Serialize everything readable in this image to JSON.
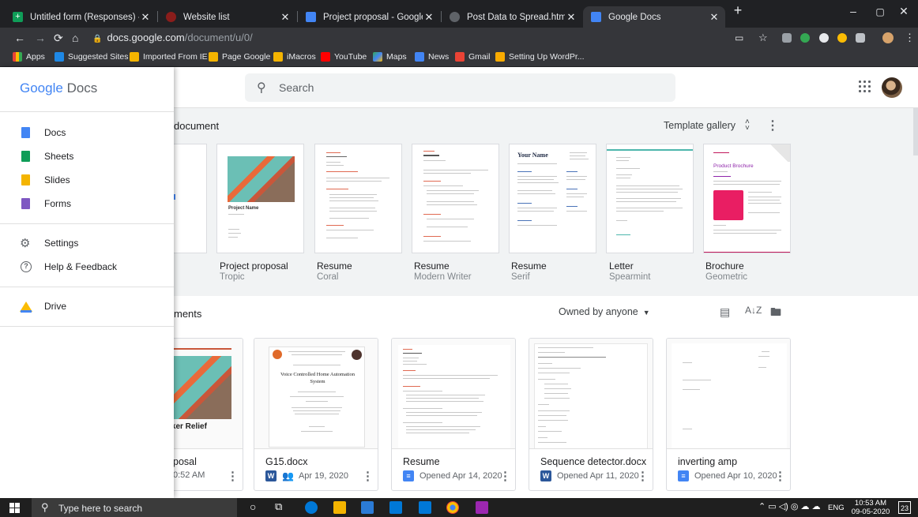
{
  "browser": {
    "tabs": [
      {
        "title": "Untitled form (Responses) - Goo",
        "color": "#0f9d58"
      },
      {
        "title": "Website list",
        "color": "#c5221f"
      },
      {
        "title": "Project proposal - Google Docs",
        "color": "#4285f4"
      },
      {
        "title": "Post Data to Spread.html",
        "color": "#5f6368"
      },
      {
        "title": "Google Docs",
        "color": "#4285f4"
      }
    ],
    "url_host": "docs.google.com",
    "url_path": "/document/u/0/",
    "bookmarks": [
      "Apps",
      "Suggested Sites",
      "Imported From IE",
      "Page Google",
      "iMacros",
      "YouTube",
      "Maps",
      "News",
      "Gmail",
      "Setting Up WordPr..."
    ]
  },
  "header": {
    "logo_google": "Google",
    "logo_docs": "Docs",
    "search_placeholder": "Search"
  },
  "drawer": {
    "apps": [
      {
        "label": "Docs",
        "color": "#4285f4"
      },
      {
        "label": "Sheets",
        "color": "#0f9d58"
      },
      {
        "label": "Slides",
        "color": "#f4b400"
      },
      {
        "label": "Forms",
        "color": "#7e57c2"
      }
    ],
    "settings": "Settings",
    "help": "Help & Feedback",
    "drive": "Drive"
  },
  "templates": {
    "heading": "document",
    "gallery": "Template gallery",
    "items": [
      {
        "name": "Project proposal",
        "sub": "Tropic"
      },
      {
        "name": "Resume",
        "sub": "Coral"
      },
      {
        "name": "Resume",
        "sub": "Modern Writer"
      },
      {
        "name": "Resume",
        "sub": "Serif"
      },
      {
        "name": "Letter",
        "sub": "Spearmint"
      },
      {
        "name": "Brochure",
        "sub": "Geometric"
      }
    ],
    "thumb_text": {
      "project_name": "Project Name",
      "your_name": "Your Name",
      "product_brochure": "Product Brochure"
    }
  },
  "recent": {
    "heading": "ments",
    "owned": "Owned by anyone",
    "docs": [
      {
        "title": "posal",
        "meta": "0:52 AM",
        "thumb": "rker Relief"
      },
      {
        "title": "G15.docx",
        "meta": "Apr 19, 2020",
        "type": "W",
        "thumb": "Voice Controlled Home Automation System"
      },
      {
        "title": "Resume",
        "meta": "Opened Apr 14, 2020",
        "type": "D"
      },
      {
        "title": "Sequence detector.docx",
        "meta": "Opened Apr 11, 2020",
        "type": "W"
      },
      {
        "title": "inverting amp",
        "meta": "Opened Apr 10, 2020",
        "type": "D"
      }
    ]
  },
  "taskbar": {
    "search_placeholder": "Type here to search",
    "lang": "ENG",
    "time": "10:53 AM",
    "date": "09-05-2020",
    "notif": "23"
  }
}
